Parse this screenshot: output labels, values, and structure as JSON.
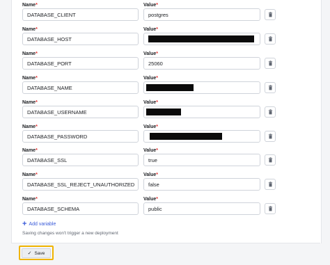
{
  "name_label": "Name",
  "value_label": "Value",
  "required_mark": "*",
  "variables": [
    {
      "name": "DATABASE_CLIENT",
      "value": "postgres",
      "redacted": false
    },
    {
      "name": "DATABASE_HOST",
      "value": "",
      "redacted": true
    },
    {
      "name": "DATABASE_PORT",
      "value": "25060",
      "redacted": false
    },
    {
      "name": "DATABASE_NAME",
      "value": "",
      "redacted": true
    },
    {
      "name": "DATABASE_USERNAME",
      "value": "",
      "redacted": true
    },
    {
      "name": "DATABASE_PASSWORD",
      "value": "",
      "redacted": true
    },
    {
      "name": "DATABASE_SSL",
      "value": "true",
      "redacted": false
    },
    {
      "name": "DATABASE_SSL_REJECT_UNAUTHORIZED",
      "value": "false",
      "redacted": false
    },
    {
      "name": "DATABASE_SCHEMA",
      "value": "public",
      "redacted": false
    }
  ],
  "add_variable_label": "Add variable",
  "hint_text": "Saving changes won't trigger a new deployment",
  "save_label": "Save",
  "icons": {
    "delete": "trash-icon",
    "add": "plus-icon",
    "save": "check-icon"
  },
  "colors": {
    "accent": "#3a5bd9",
    "highlight": "#f0b400",
    "required": "#e02f2f"
  }
}
